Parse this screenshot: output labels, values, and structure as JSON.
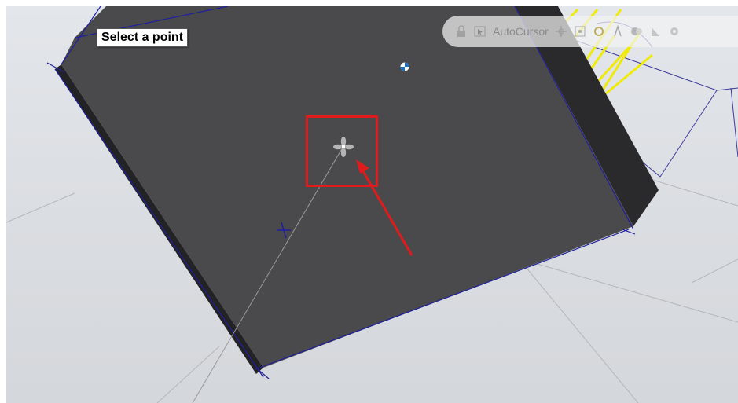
{
  "prompt": {
    "text": "Select a point"
  },
  "toolbar": {
    "autocursor_label": "AutoCursor",
    "icons": [
      "lock-icon",
      "cursor-frame-icon",
      "snap-toggle-icon",
      "point-snap-icon",
      "midpoint-snap-icon",
      "center-snap-icon",
      "grid-snap-icon",
      "angle-snap-icon",
      "settings-icon"
    ]
  },
  "colors": {
    "plate_top": "#4b4b4d",
    "plate_side": "#2b2b2d",
    "edge_lines": "#1a1a9a",
    "wireframe": "#f5f00a",
    "annotation": "#e41b1b"
  }
}
